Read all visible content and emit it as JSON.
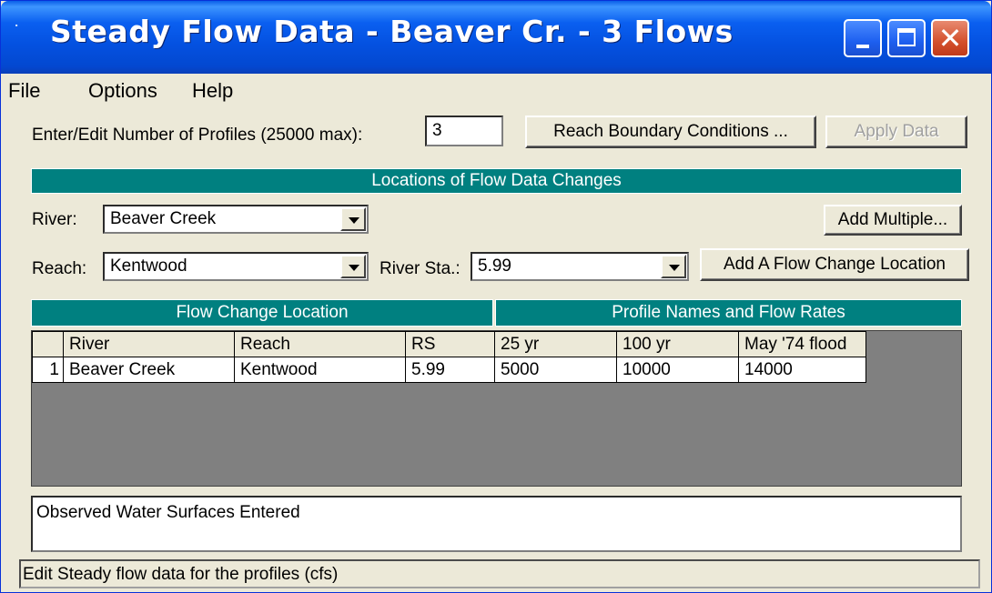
{
  "window": {
    "title": "Steady Flow Data - Beaver Cr. - 3 Flows"
  },
  "menu": [
    "File",
    "Options",
    "Help"
  ],
  "profiles": {
    "label": "Enter/Edit Number of Profiles (25000 max):",
    "value": "3"
  },
  "buttons": {
    "reach_boundary": "Reach Boundary Conditions ...",
    "apply_data": "Apply Data",
    "add_multiple": "Add Multiple...",
    "add_flow_change": "Add A Flow Change Location"
  },
  "locations_header": "Locations of Flow Data Changes",
  "river": {
    "label": "River:",
    "value": "Beaver Creek"
  },
  "reach": {
    "label": "Reach:",
    "value": "Kentwood"
  },
  "river_sta": {
    "label": "River Sta.:",
    "value": "5.99"
  },
  "table": {
    "group_headers": [
      "Flow Change Location",
      "Profile Names and Flow Rates"
    ],
    "columns": [
      "River",
      "Reach",
      "RS",
      "25 yr",
      "100 yr",
      "May '74 flood"
    ],
    "rows": [
      {
        "num": "1",
        "cells": [
          "Beaver Creek",
          "Kentwood",
          "5.99",
          "5000",
          "10000",
          "14000"
        ]
      }
    ]
  },
  "description": "Observed Water Surfaces Entered",
  "status": "Edit Steady flow data for the profiles (cfs)"
}
